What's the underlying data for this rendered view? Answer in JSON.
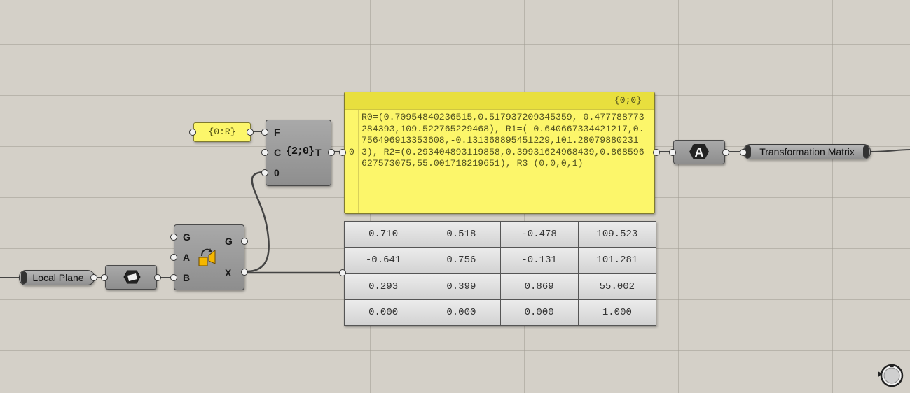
{
  "canvas": {
    "background": "#d4d0c8",
    "grid_color": "#a09c94"
  },
  "local_plane": {
    "label": "Local Plane"
  },
  "param_plane": {
    "icon": "plane-param-icon"
  },
  "orient_component": {
    "inputs": [
      "G",
      "A",
      "B"
    ],
    "outputs": [
      "G",
      "X"
    ],
    "icon": "orient-transform-icon"
  },
  "path_panel": {
    "text": "{0:R}"
  },
  "replace_paths": {
    "inputs": [
      "F",
      "C",
      "0"
    ],
    "output": "T",
    "icon_text": "{2;0}"
  },
  "text_panel": {
    "path": "{0;0}",
    "index": "0",
    "text": "R0=(0.70954840236515,0.517937209345359,-0.477788773284393,109.522765229468), R1=(-0.640667334421217,0.756496913353608,-0.131368895451229,101.280798802313), R2=(0.293404893119858,0.39931624968439,0.868596627573075,55.001718219651), R3=(0,0,0,1)"
  },
  "matrix_table": [
    [
      "0.710",
      "0.518",
      "-0.478",
      "109.523"
    ],
    [
      "-0.641",
      "0.756",
      "-0.131",
      "101.281"
    ],
    [
      "0.293",
      "0.399",
      "0.869",
      "55.002"
    ],
    [
      "0.000",
      "0.000",
      "0.000",
      "1.000"
    ]
  ],
  "text_param": {
    "icon_letter": "A"
  },
  "output_label": {
    "label": "Transformation Matrix"
  },
  "navigation": {
    "icon": "view-compass-icon"
  }
}
